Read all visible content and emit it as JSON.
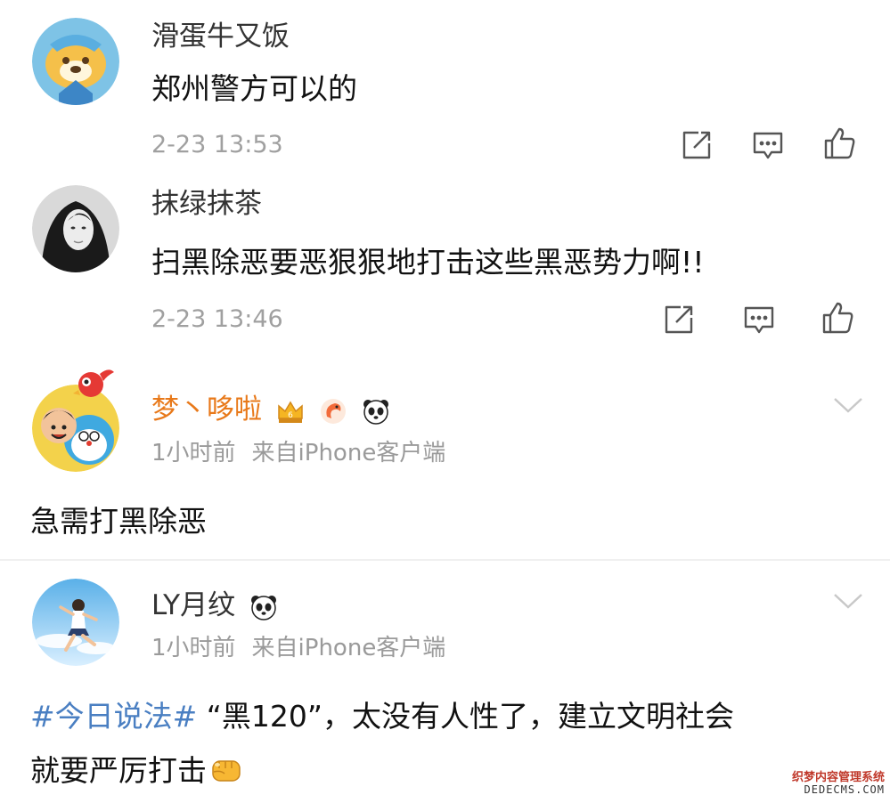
{
  "comments": [
    {
      "username": "滑蛋牛又饭",
      "text": "郑州警方可以的",
      "time": "2-23 13:53",
      "actions": [
        "share-icon",
        "comment-icon",
        "like-icon"
      ]
    },
    {
      "username": "抹绿抹茶",
      "text": "扫黑除恶要恶狠狠地打击这些黑恶势力啊!!",
      "time": "2-23 13:46",
      "actions": [
        "share-icon",
        "comment-icon",
        "like-icon"
      ]
    }
  ],
  "posts": [
    {
      "username": "梦丶哆啦",
      "username_color": "#e8791a",
      "badges": [
        "crown-badge-icon",
        "shrimp-badge-icon",
        "panda-badge-icon"
      ],
      "time": "1小时前",
      "source": "来自iPhone客户端",
      "lines": [
        "急需打黑除恶"
      ]
    },
    {
      "username": "LY月纹",
      "badges": [
        "panda-badge-icon"
      ],
      "time": "1小时前",
      "source": "来自iPhone客户端",
      "hashtag": "#今日说法#",
      "line1_rest": " “黑120”，太没有人性了，建立文明社会",
      "line2": "就要严厉打击",
      "emoji": "fist-emoji-icon"
    }
  ],
  "watermark": {
    "line1": "织梦内容管理系统",
    "line2": "DEDECMS.COM"
  },
  "colors": {
    "hashtag": "#4a7fc2",
    "orange_name": "#e8791a",
    "meta_gray": "#a0a0a0"
  }
}
